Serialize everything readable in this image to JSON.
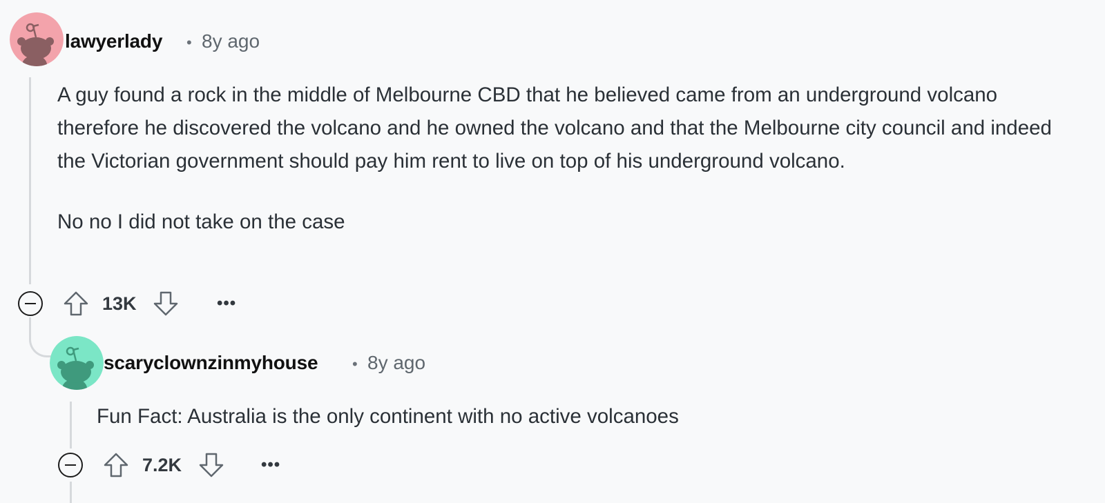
{
  "comments": [
    {
      "username": "lawyerlady",
      "separator": "•",
      "timestamp": "8y ago",
      "avatar_color": "#f3a3ab",
      "avatar_icon": "snoo-avatar-icon",
      "paragraphs": [
        "A guy found a rock in the middle of Melbourne CBD that he believed came from an underground volcano therefore he discovered the volcano and he owned the volcano and that the Melbourne city council and indeed the Victorian government should pay him rent to live on top of his underground volcano.",
        "No no I did not take on the case"
      ],
      "votes": "13K",
      "more_label": "•••"
    },
    {
      "username": "scaryclownzinmyhouse",
      "separator": "•",
      "timestamp": "8y ago",
      "avatar_color": "#7be6c6",
      "avatar_icon": "snoo-avatar-icon",
      "paragraphs": [
        "Fun Fact: Australia is the only continent with no active volcanoes"
      ],
      "votes": "7.2K",
      "more_label": "•••"
    }
  ],
  "colors": {
    "background": "#f8f9fa",
    "thread_line": "#d6d9dc",
    "text": "#2a3036"
  }
}
